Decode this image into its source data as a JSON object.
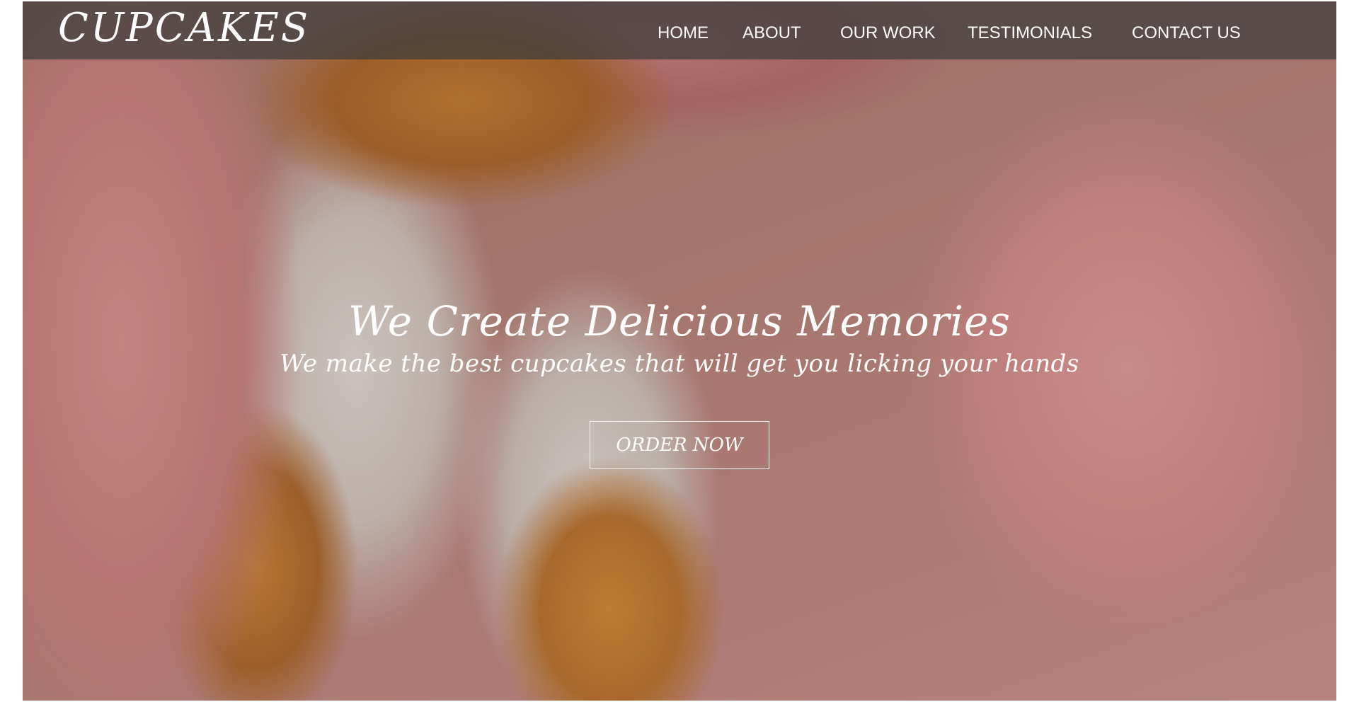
{
  "header": {
    "brand": "CUPCAKES",
    "nav": {
      "home": "HOME",
      "about": "ABOUT",
      "our_work": "OUR WORK",
      "testimonials": "TESTIMONIALS",
      "contact_us": "CONTACT US"
    }
  },
  "hero": {
    "headline": "We Create Delicious Memories",
    "subheadline": "We make the best cupcakes that will get you licking your hands",
    "cta_label": "ORDER NOW"
  },
  "colors": {
    "navbar_bg": "#3c3c3c",
    "text": "#ffffff",
    "frosting_pink": "#e59894",
    "cake_orange": "#d1852f"
  }
}
